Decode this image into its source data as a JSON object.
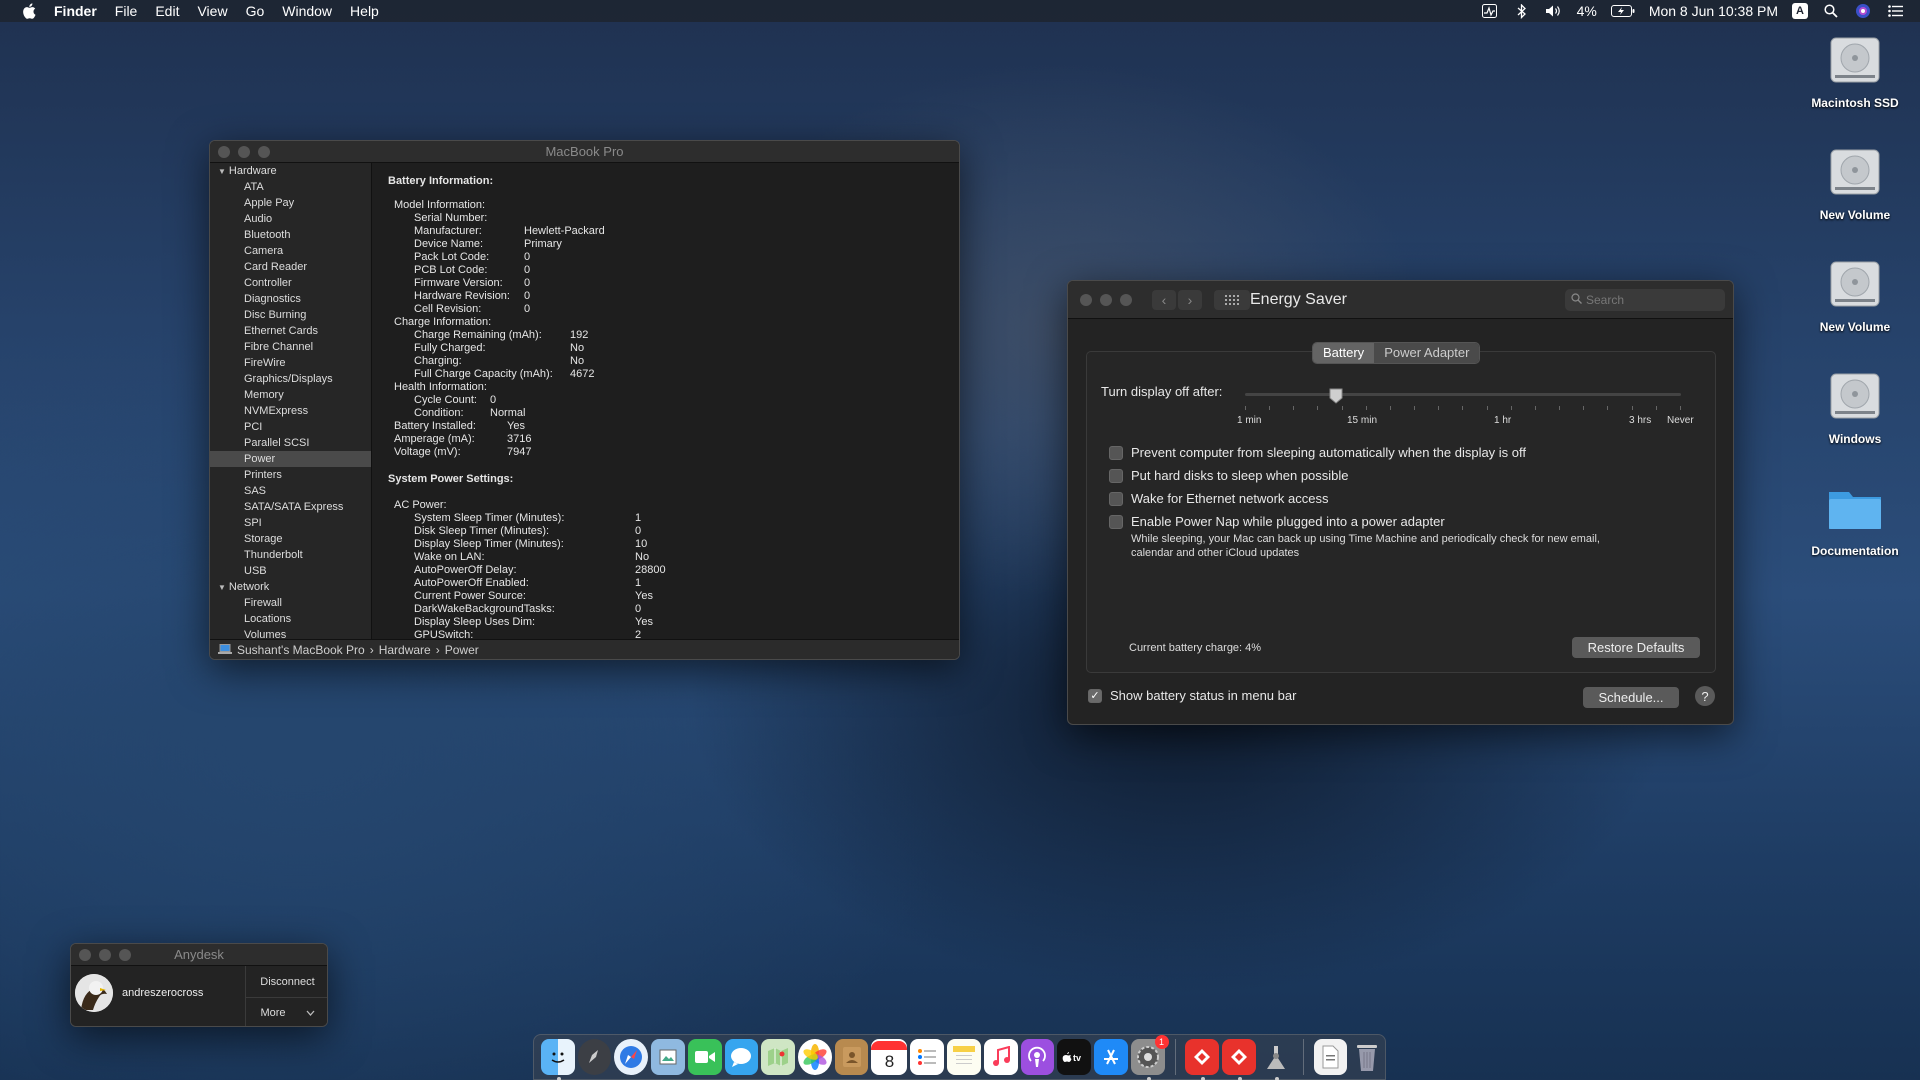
{
  "menubar": {
    "app": "Finder",
    "items": [
      "File",
      "Edit",
      "View",
      "Go",
      "Window",
      "Help"
    ],
    "battery_percent": "4%",
    "datetime": "Mon 8 Jun  10:38 PM",
    "input_letter": "A"
  },
  "desktop_icons": [
    {
      "label": "Macintosh SSD"
    },
    {
      "label": "New Volume"
    },
    {
      "label": "New Volume"
    },
    {
      "label": "Windows"
    },
    {
      "label": "Documentation"
    }
  ],
  "sysinfo": {
    "title": "MacBook Pro",
    "sidebar": {
      "hardware": "Hardware",
      "hardware_items": [
        "ATA",
        "Apple Pay",
        "Audio",
        "Bluetooth",
        "Camera",
        "Card Reader",
        "Controller",
        "Diagnostics",
        "Disc Burning",
        "Ethernet Cards",
        "Fibre Channel",
        "FireWire",
        "Graphics/Displays",
        "Memory",
        "NVMExpress",
        "PCI",
        "Parallel SCSI",
        "Power",
        "Printers",
        "SAS",
        "SATA/SATA Express",
        "SPI",
        "Storage",
        "Thunderbolt",
        "USB"
      ],
      "network": "Network",
      "network_items": [
        "Firewall",
        "Locations",
        "Volumes"
      ]
    },
    "battery_heading": "Battery Information:",
    "battery_rows": [
      {
        "key": "Model Information:",
        "val": ""
      },
      {
        "key": "Serial Number:",
        "val": ""
      },
      {
        "key": "Manufacturer:",
        "val": "Hewlett-Packard"
      },
      {
        "key": "Device Name:",
        "val": "Primary"
      },
      {
        "key": "Pack Lot Code:",
        "val": "0"
      },
      {
        "key": "PCB Lot Code:",
        "val": "0"
      },
      {
        "key": "Firmware Version:",
        "val": "0"
      },
      {
        "key": "Hardware Revision:",
        "val": "0"
      },
      {
        "key": "Cell Revision:",
        "val": "0"
      },
      {
        "key": "Charge Information:",
        "val": ""
      },
      {
        "key": "Charge Remaining (mAh):",
        "val": "192"
      },
      {
        "key": "Fully Charged:",
        "val": "No"
      },
      {
        "key": "Charging:",
        "val": "No"
      },
      {
        "key": "Full Charge Capacity (mAh):",
        "val": "4672"
      },
      {
        "key": "Health Information:",
        "val": ""
      },
      {
        "key": "Cycle Count:",
        "val": "0"
      },
      {
        "key": "Condition:",
        "val": "Normal"
      },
      {
        "key": "Battery Installed:",
        "val": "Yes"
      },
      {
        "key": "Amperage (mA):",
        "val": "3716"
      },
      {
        "key": "Voltage (mV):",
        "val": "7947"
      }
    ],
    "power_heading": "System Power Settings:",
    "ac_heading": "AC Power:",
    "power_rows": [
      {
        "key": "System Sleep Timer (Minutes):",
        "val": "1"
      },
      {
        "key": "Disk Sleep Timer (Minutes):",
        "val": "0"
      },
      {
        "key": "Display Sleep Timer (Minutes):",
        "val": "10"
      },
      {
        "key": "Wake on LAN:",
        "val": "No"
      },
      {
        "key": "AutoPowerOff Delay:",
        "val": "28800"
      },
      {
        "key": "AutoPowerOff Enabled:",
        "val": "1"
      },
      {
        "key": "Current Power Source:",
        "val": "Yes"
      },
      {
        "key": "DarkWakeBackgroundTasks:",
        "val": "0"
      },
      {
        "key": "Display Sleep Uses Dim:",
        "val": "Yes"
      },
      {
        "key": "GPUSwitch:",
        "val": "2"
      }
    ],
    "path": [
      "Sushant's MacBook Pro",
      "Hardware",
      "Power"
    ]
  },
  "energy": {
    "title": "Energy Saver",
    "search_placeholder": "Search",
    "tabs": [
      "Battery",
      "Power Adapter"
    ],
    "slider_label": "Turn display off after:",
    "slider_ticks": [
      "1 min",
      "15 min",
      "1 hr",
      "3 hrs",
      "Never"
    ],
    "slider_value": "15 min",
    "options": [
      {
        "label": "Prevent computer from sleeping automatically when the display is off",
        "checked": false
      },
      {
        "label": "Put hard disks to sleep when possible",
        "checked": false
      },
      {
        "label": "Wake for Ethernet network access",
        "checked": false
      },
      {
        "label": "Enable Power Nap while plugged into a power adapter",
        "checked": false
      }
    ],
    "powernap_desc_1": "While sleeping, your Mac can back up using Time Machine and periodically check for new email,",
    "powernap_desc_2": "calendar and other iCloud updates",
    "battery_charge": "Current battery charge: 4%",
    "restore": "Restore Defaults",
    "show_status": "Show battery status in menu bar",
    "schedule": "Schedule...",
    "help": "?"
  },
  "anydesk": {
    "title": "Anydesk",
    "user": "andreszerocross",
    "disconnect": "Disconnect",
    "more": "More"
  },
  "dock": {
    "calendar_day": "8",
    "badge": "1"
  },
  "colors": {
    "accent": "#2f7ae5",
    "window_bg": "#1e1e1e",
    "sidebar_sel": "#4a4a4a"
  }
}
